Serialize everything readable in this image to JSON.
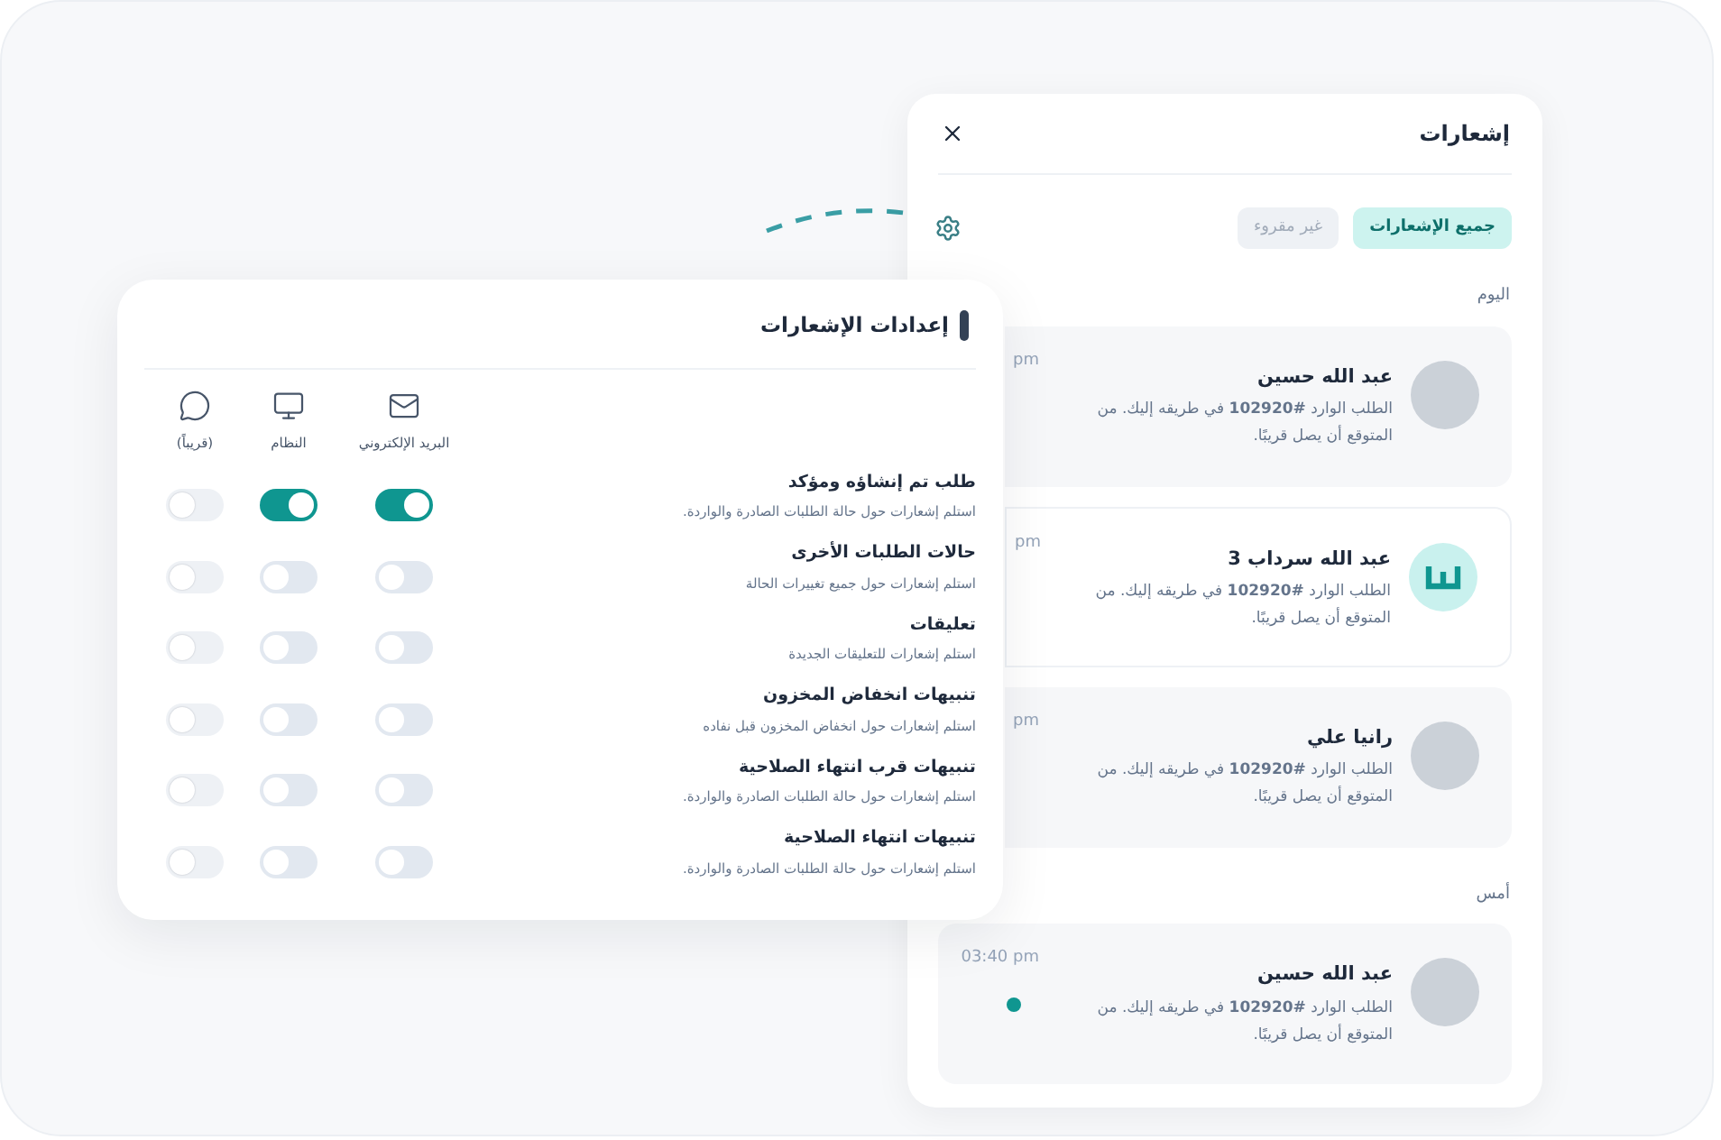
{
  "notifications": {
    "title": "إشعارات",
    "tabs": [
      {
        "label": "جميع الإشعارات",
        "selected": true
      },
      {
        "label": "غير مقروء",
        "selected": false
      }
    ],
    "groups": [
      {
        "label": "اليوم",
        "items": [
          {
            "name": "عبد الله حسين",
            "message": "الطلب الوارد **#102920** في طريقه إليك. من المتوقع أن يصل قريبًا.",
            "time": "pm",
            "kind": "photo",
            "highlighted": true,
            "unread": false
          },
          {
            "name": "عبد الله سرداب 3",
            "message": "الطلب الوارد **#102920** في طريقه إليك. من المتوقع أن يصل قريبًا.",
            "time": "pm",
            "kind": "logo",
            "highlighted": false,
            "unread": false
          },
          {
            "name": "رانيا علي",
            "message": "الطلب الوارد **#102920** في طريقه إليك. من المتوقع أن يصل قريبًا.",
            "time": "pm",
            "kind": "photo",
            "highlighted": true,
            "unread": false
          }
        ]
      },
      {
        "label": "أمس",
        "items": [
          {
            "name": "عبد الله حسين",
            "message": "الطلب الوارد **#102920** في طريقه إليك. من المتوقع أن يصل قريبًا.",
            "time": "03:40 pm",
            "kind": "photo",
            "highlighted": true,
            "unread": true
          }
        ]
      }
    ]
  },
  "settings": {
    "title": "إعدادات الإشعارات",
    "columns": [
      {
        "label": "البريد الإلكتروني",
        "kind": "email",
        "disabled": false
      },
      {
        "label": "النظام",
        "kind": "system",
        "disabled": false
      },
      {
        "label": "(قريباً)",
        "kind": "whatsapp",
        "disabled": true
      }
    ],
    "rows": [
      {
        "title": "طلب تم إنشاؤه ومؤكد",
        "description": "استلم إشعارات حول حالة الطلبات الصادرة والواردة.",
        "toggles": [
          {
            "on": true
          },
          {
            "on": true
          },
          {
            "on": false
          }
        ]
      },
      {
        "title": "حالات الطلبات الأخرى",
        "description": "استلم إشعارات حول جميع تغييرات الحالة",
        "toggles": [
          {
            "on": false
          },
          {
            "on": false
          },
          {
            "on": false
          }
        ]
      },
      {
        "title": "تعليقات",
        "description": "استلم إشعارات للتعليقات الجديدة",
        "toggles": [
          {
            "on": false
          },
          {
            "on": false
          },
          {
            "on": false
          }
        ]
      },
      {
        "title": "تنبيهات انخفاض المخزون",
        "description": "استلم إشعارات حول انخفاض المخزون قبل نفاده",
        "toggles": [
          {
            "on": false
          },
          {
            "on": false
          },
          {
            "on": false
          }
        ]
      },
      {
        "title": "تنبيهات قرب انتهاء الصلاحية",
        "description": "استلم إشعارات حول حالة الطلبات الصادرة والواردة.",
        "toggles": [
          {
            "on": false
          },
          {
            "on": false
          },
          {
            "on": false
          }
        ]
      },
      {
        "title": "تنبيهات انتهاء الصلاحية",
        "description": "استلم إشعارات حول حالة الطلبات الصادرة والواردة.",
        "toggles": [
          {
            "on": false
          },
          {
            "on": false
          },
          {
            "on": false
          }
        ]
      }
    ]
  }
}
